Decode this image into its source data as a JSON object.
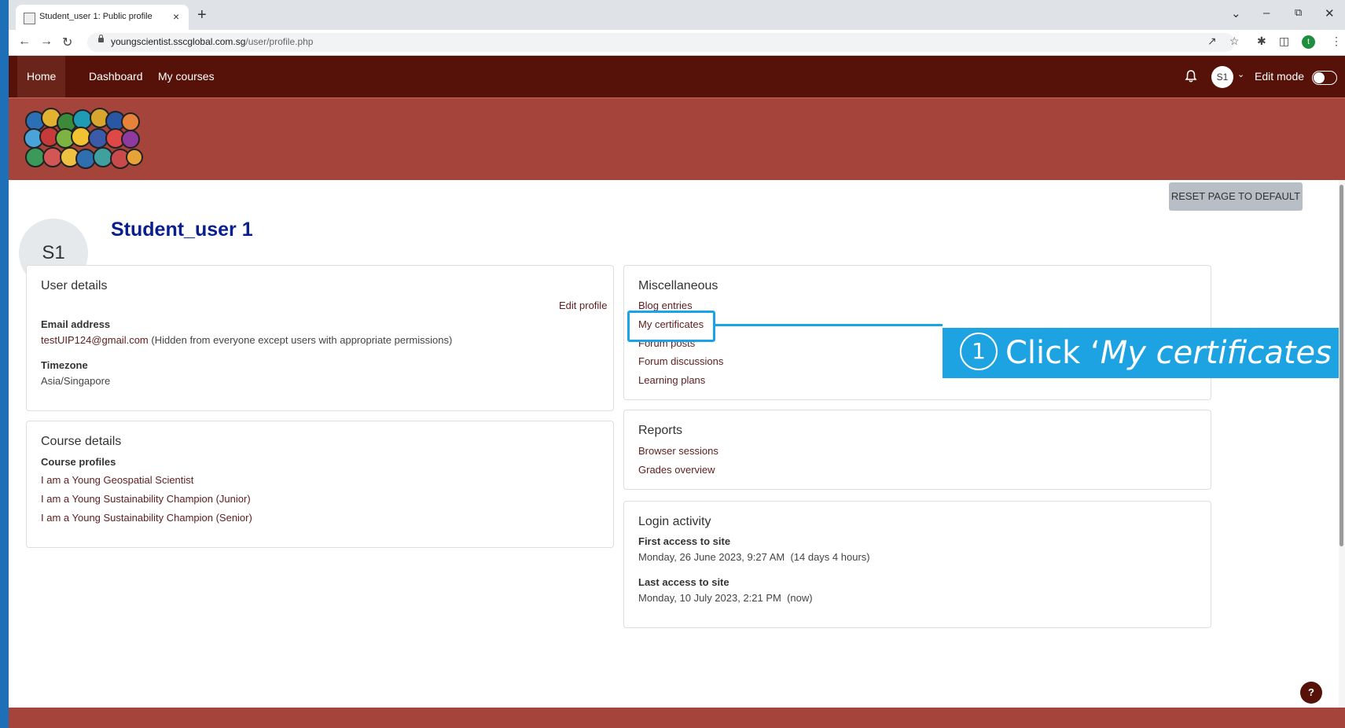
{
  "browser": {
    "tab_title": "Student_user 1: Public profile",
    "tab_close": "×",
    "new_tab": "+",
    "url_host": "youngscientist.sscglobal.com.sg",
    "url_path": "/user/profile.php",
    "profile_initial": "t"
  },
  "navbar": {
    "items": [
      {
        "label": "Home"
      },
      {
        "label": "Dashboard"
      },
      {
        "label": "My courses"
      }
    ],
    "user_initials": "S1",
    "edit_mode_label": "Edit mode"
  },
  "page": {
    "reset_button": "RESET PAGE TO DEFAULT",
    "avatar_initials": "S1",
    "full_name": "Student_user 1"
  },
  "user_details": {
    "title": "User details",
    "edit_profile": "Edit profile",
    "email_label": "Email address",
    "email_value": "testUIP124@gmail.com",
    "email_note": " (Hidden from everyone except users with appropriate permissions)",
    "timezone_label": "Timezone",
    "timezone_value": "Asia/Singapore"
  },
  "course_details": {
    "title": "Course details",
    "profiles_label": "Course profiles",
    "courses": [
      "I am a Young Geospatial Scientist",
      "I am a Young Sustainability Champion (Junior)",
      "I am a Young Sustainability Champion (Senior)"
    ]
  },
  "miscellaneous": {
    "title": "Miscellaneous",
    "links": [
      "Blog entries",
      "My certificates",
      "Forum posts",
      "Forum discussions",
      "Learning plans"
    ]
  },
  "reports": {
    "title": "Reports",
    "links": [
      "Browser sessions",
      "Grades overview"
    ]
  },
  "login_activity": {
    "title": "Login activity",
    "first_label": "First access to site",
    "first_value": "Monday, 26 June 2023, 9:27 AM  (14 days 4 hours)",
    "last_label": "Last access to site",
    "last_value": "Monday, 10 July 2023, 2:21 PM  (now)"
  },
  "callout": {
    "number": "1",
    "prefix": "Click ‘",
    "target": "My certificates"
  },
  "help_label": "?",
  "colors": {
    "navbar": "#561209",
    "banner": "#a5443a",
    "callout": "#1da3e2",
    "name": "#0a1f8f",
    "link": "#5f2020"
  }
}
